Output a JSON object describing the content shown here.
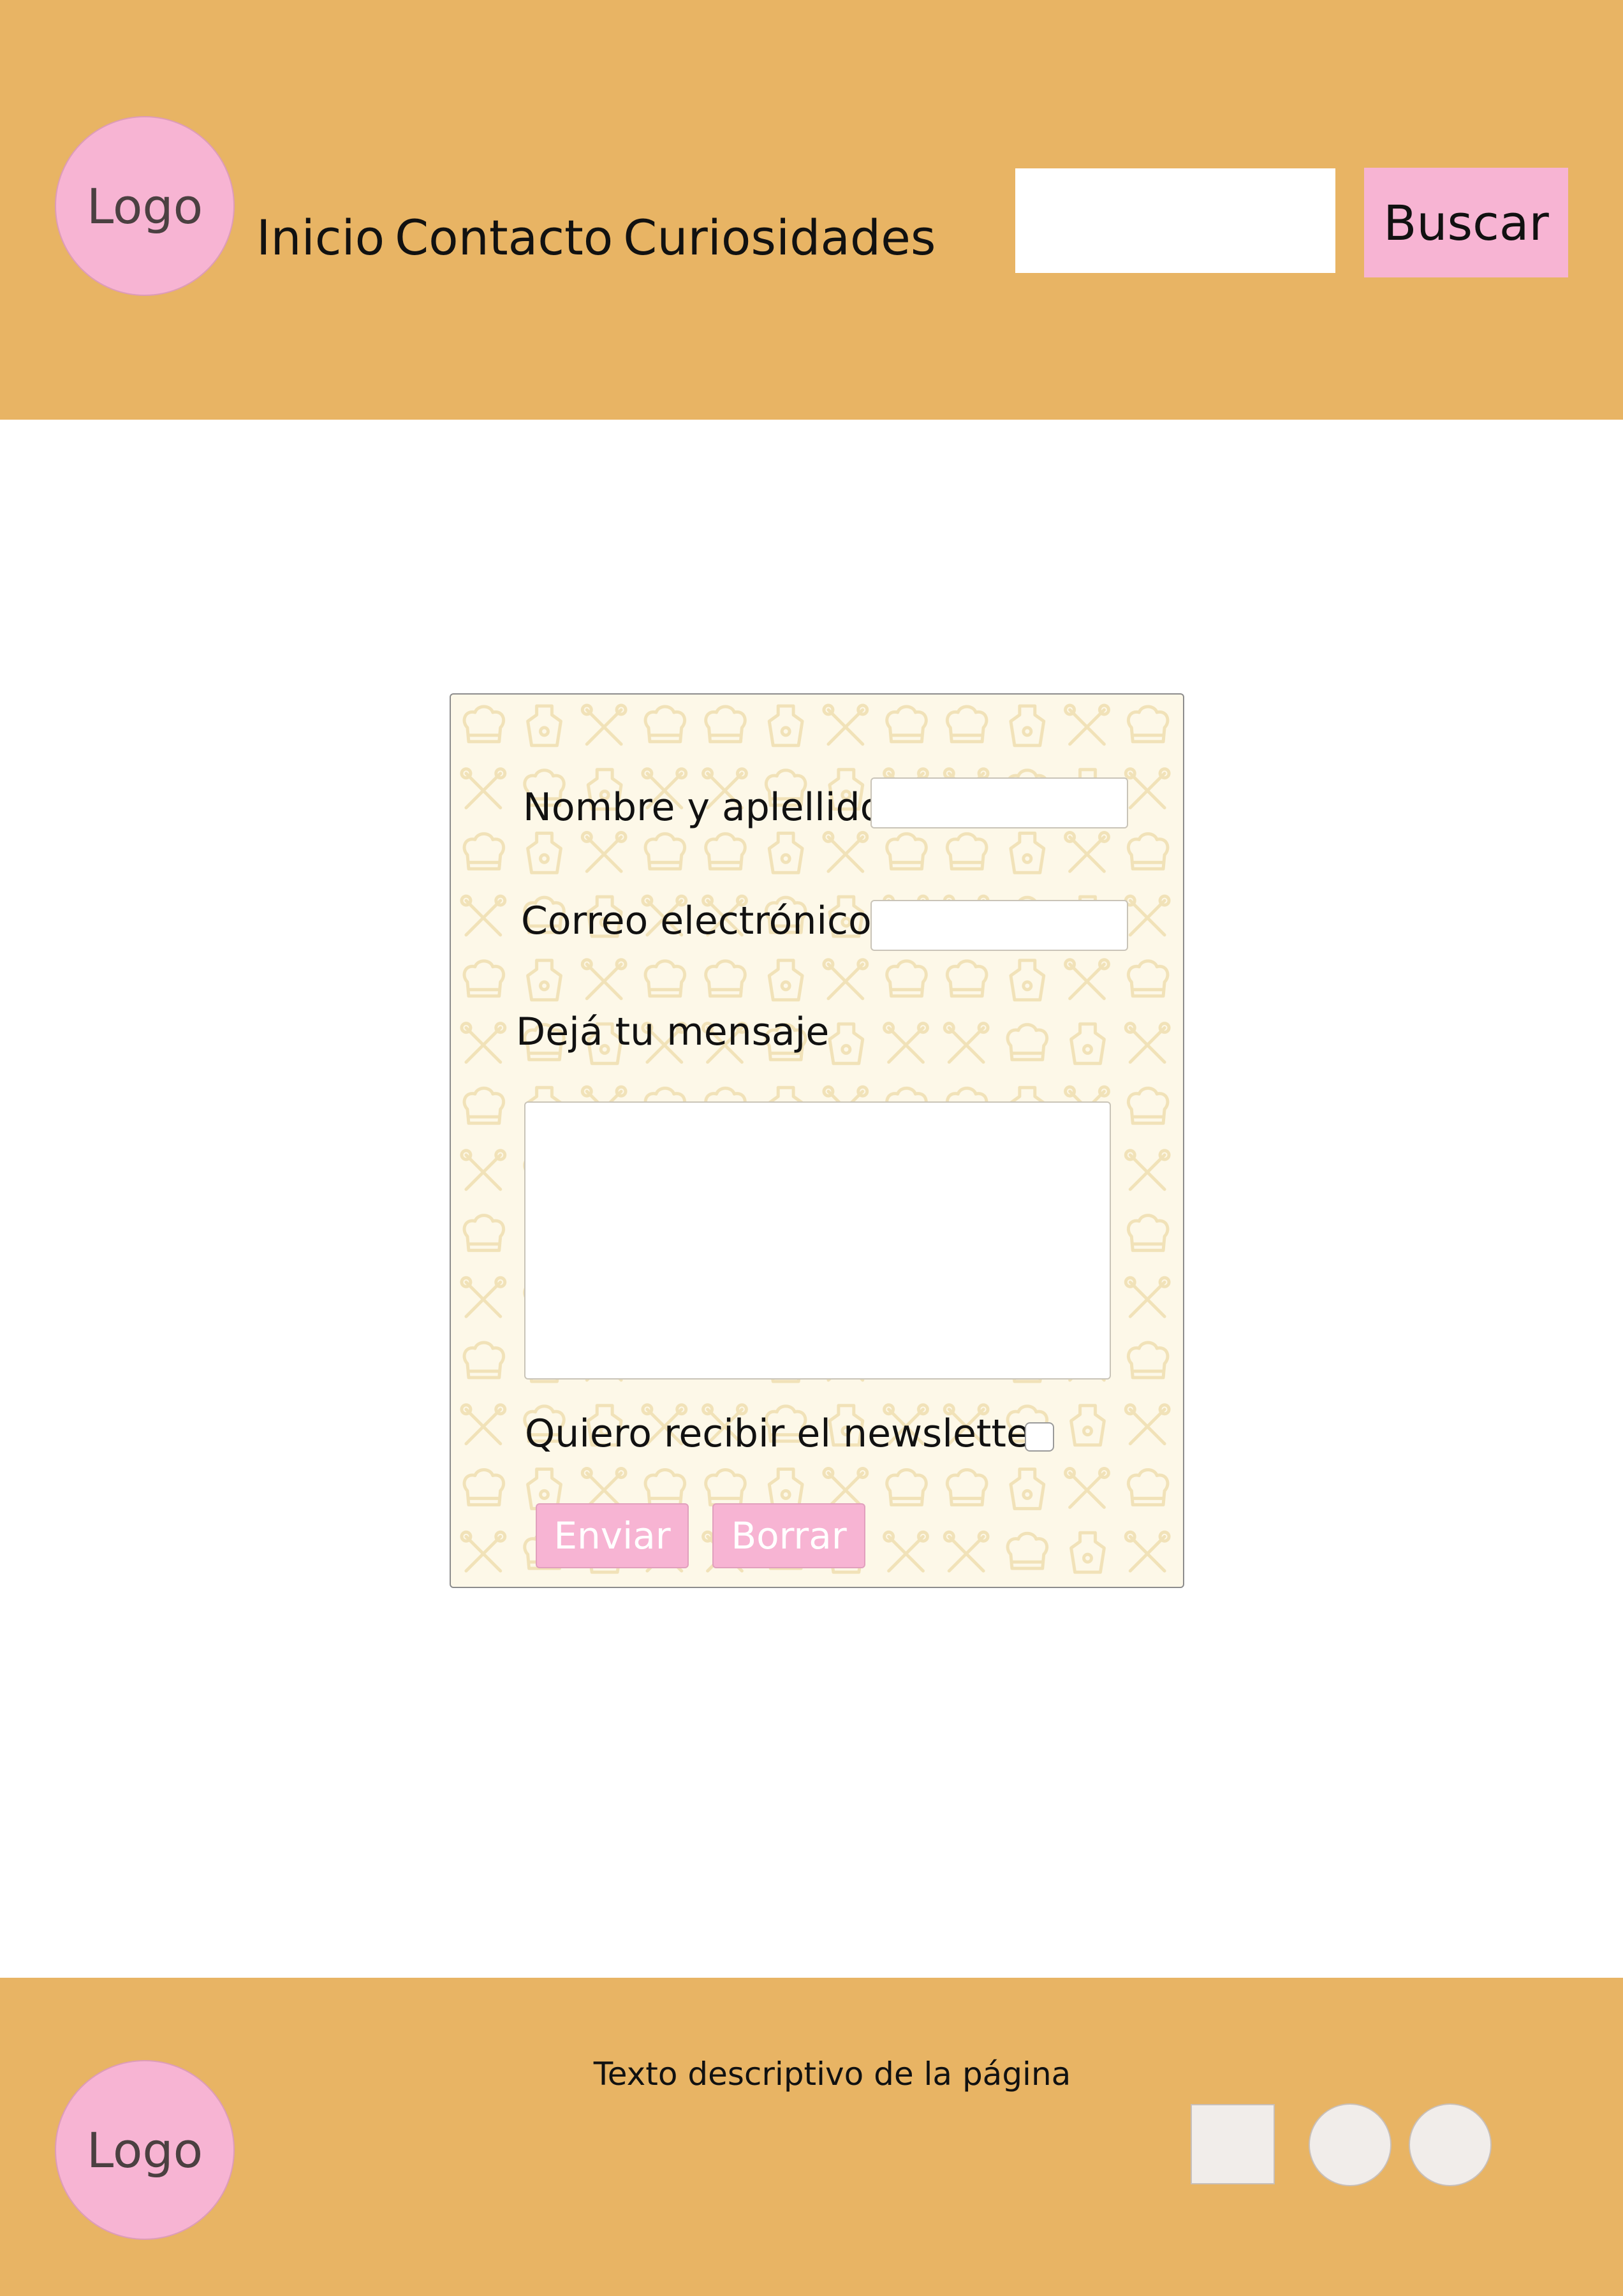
{
  "header": {
    "logo_text": "Logo",
    "nav": [
      "Inicio",
      "Contacto",
      "Curiosidades"
    ],
    "search": {
      "value": "",
      "button_label": "Buscar"
    }
  },
  "form": {
    "name_label": "Nombre y aplellido:",
    "email_label": "Correo electrónico:",
    "message_label": "Dejá tu mensaje",
    "newsletter_label": "Quiero recibir el newsletter",
    "newsletter_checked": false,
    "submit_label": "Enviar",
    "reset_label": "Borrar",
    "background_icons": [
      "chef-hat-icon",
      "apron-icon",
      "crossed-utensils-icon"
    ]
  },
  "footer": {
    "logo_text": "Logo",
    "description": "Texto descriptivo de la página",
    "social_icons": [
      "square-social-icon",
      "circle-social-icon",
      "circle-social-icon"
    ]
  },
  "colors": {
    "brand": "#e8b464",
    "accent_pink": "#f7b4d3",
    "form_background": "#fdf8e8",
    "page_background": "#ffffff"
  }
}
